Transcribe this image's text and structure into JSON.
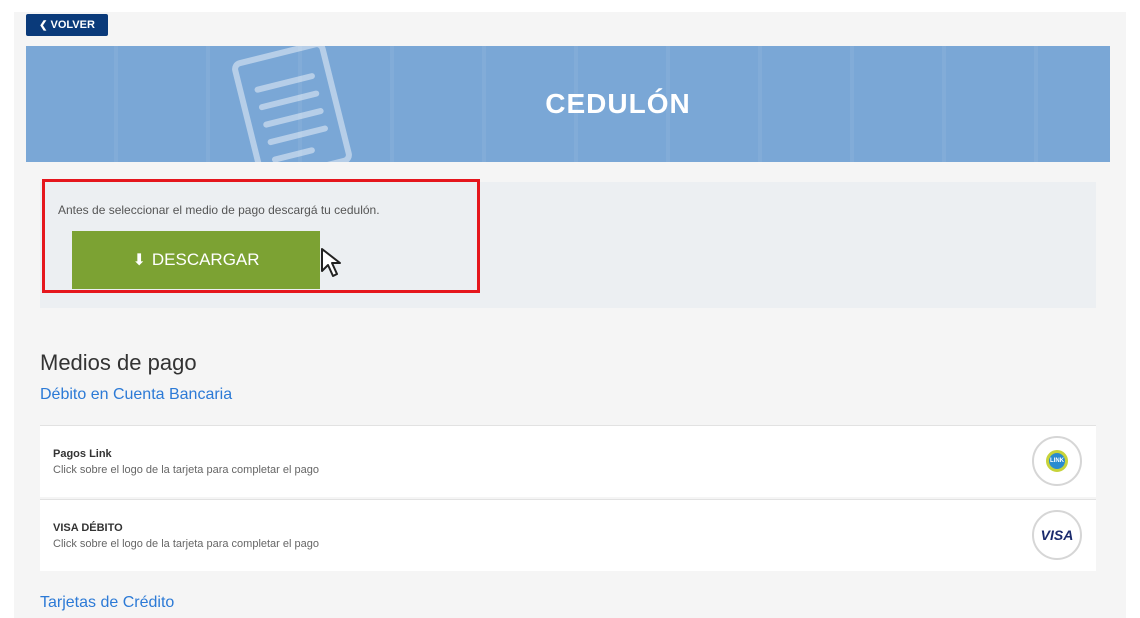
{
  "back_button": {
    "label": "VOLVER",
    "icon": "chevron-left-icon"
  },
  "banner": {
    "title": "CEDULÓN",
    "icon": "document-icon",
    "color": "#7aa7d6"
  },
  "download": {
    "instruction": "Antes de seleccionar el medio de pago descargá tu cedulón.",
    "button_label": "DESCARGAR",
    "button_icon": "download-icon",
    "button_color": "#7ca233",
    "highlight_color": "#e5161d"
  },
  "payment": {
    "title": "Medios de pago",
    "debit_section": "Débito en Cuenta Bancaria",
    "methods": [
      {
        "name": "Pagos Link",
        "description": "Click sobre el logo de la tarjeta para completar el pago",
        "logo": "link-logo",
        "logo_text": "LINK"
      },
      {
        "name": "VISA DÉBITO",
        "description": "Click sobre el logo de la tarjeta para completar el pago",
        "logo": "visa-logo",
        "logo_text": "VISA"
      }
    ],
    "credit_section": "Tarjetas de Crédito"
  },
  "link_color": "#2c7ad6"
}
